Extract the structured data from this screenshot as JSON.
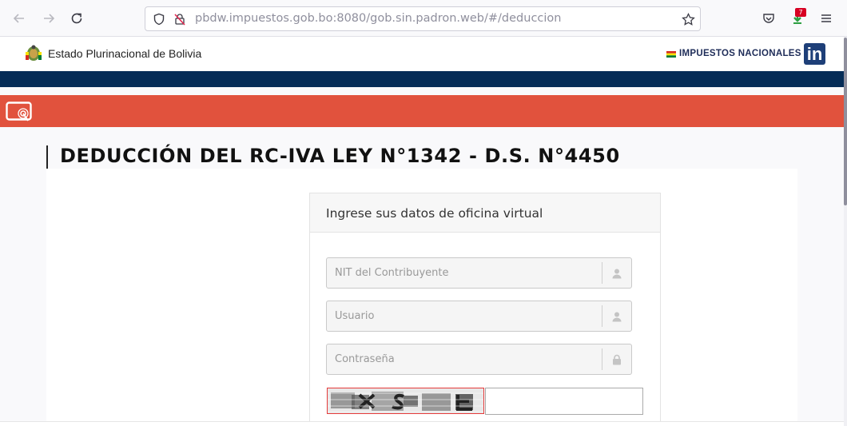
{
  "browser": {
    "url_host": "pbdw.impuestos.gob.bo",
    "url_path": ":8080/gob.sin.padron.web/#/deduccion",
    "notification_count": "7"
  },
  "header": {
    "gov_name": "Estado Plurinacional de Bolivia",
    "brand": "IMPUESTOS NACIONALES",
    "logo_letters": "in"
  },
  "page": {
    "title": "DEDUCCIÓN DEL RC-IVA LEY N°1342 - D.S. N°4450"
  },
  "login": {
    "card_title": "Ingrese sus datos de oficina virtual",
    "nit_placeholder": "NIT del Contribuyente",
    "user_placeholder": "Usuario",
    "password_placeholder": "Contraseña",
    "captcha_value": ""
  },
  "colors": {
    "navy": "#052c57",
    "red_band": "#e1523d",
    "brand_blue": "#1e2c58"
  },
  "icons": {
    "back": "arrow-left-icon",
    "forward": "arrow-right-icon",
    "reload": "reload-icon",
    "shield": "shield-icon",
    "blocked": "insecure-icon",
    "star": "star-icon",
    "pocket": "pocket-icon",
    "extension": "download-icon",
    "menu": "hamburger-menu-icon",
    "nit_addon": "user-icon",
    "user_addon": "user-icon",
    "password_addon": "lock-icon"
  }
}
